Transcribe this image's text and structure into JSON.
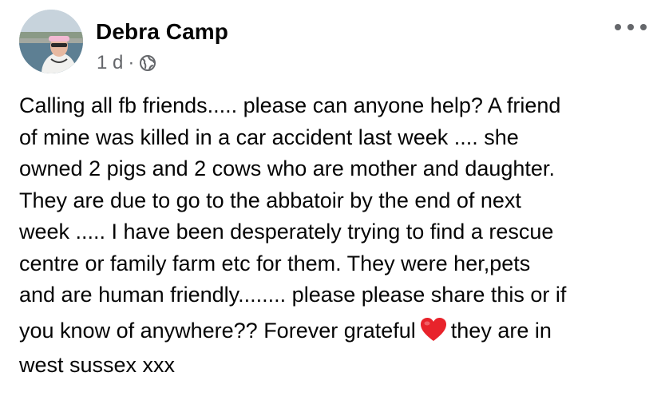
{
  "post": {
    "author": "Debra Camp",
    "timestamp": "1 d",
    "separator": "·",
    "audience_icon": "globe-icon",
    "more_icon": "more-options-icon",
    "body_lines": [
      "Calling all fb friends..... please can anyone help? A friend",
      "of mine was killed in a car accident last week .... she",
      "owned 2 pigs and 2 cows who are mother and daughter.",
      "They are due to go to the abbatoir by the end of next",
      "week ..... I have been desperately trying to find a rescue",
      "centre or family farm etc for them. They were her,pets",
      "and are human friendly........ please please share this or if"
    ],
    "body_line8_before": "you know of anywhere?? Forever grateful",
    "body_line8_emoji": "red-heart-emoji",
    "body_line8_after": "they are in",
    "body_line9": "west sussex xxx"
  },
  "colors": {
    "text": "#050505",
    "secondary": "#65676b",
    "heart": "#e8232b"
  }
}
